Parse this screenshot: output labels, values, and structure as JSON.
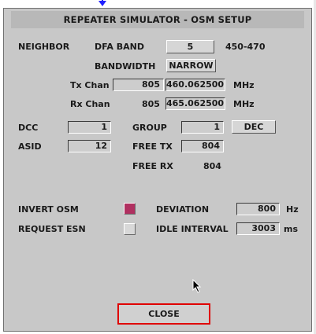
{
  "title": "REPEATER SIMULATOR - OSM SETUP",
  "neighbor": {
    "label": "NEIGHBOR",
    "band_label": "DFA BAND",
    "band_value": "5",
    "band_range": "450-470",
    "bandwidth_label": "BANDWIDTH",
    "bandwidth_value": "NARROW"
  },
  "tx": {
    "label": "Tx Chan",
    "chan": "805",
    "freq": "460.062500",
    "unit": "MHz"
  },
  "rx": {
    "label": "Rx Chan",
    "chan": "805",
    "freq": "465.062500",
    "unit": "MHz"
  },
  "dcc": {
    "label": "DCC",
    "value": "1"
  },
  "group": {
    "label": "GROUP",
    "value": "1",
    "dec_button": "DEC"
  },
  "asid": {
    "label": "ASID",
    "value": "12"
  },
  "free_tx": {
    "label": "FREE TX",
    "value": "804"
  },
  "free_rx": {
    "label": "FREE RX",
    "value": "804"
  },
  "invert_osm": {
    "label": "INVERT OSM",
    "checked": true,
    "color": "#b03060"
  },
  "request_esn": {
    "label": "REQUEST ESN",
    "checked": false
  },
  "deviation": {
    "label": "DEVIATION",
    "value": "800",
    "unit": "Hz"
  },
  "idle_interval": {
    "label": "IDLE INTERVAL",
    "value": "3003",
    "unit": "ms"
  },
  "close_label": "CLOSE",
  "colors": {
    "window_bg": "#c8c8c8",
    "title_bg": "#b8b8b8",
    "highlight": "#e00000",
    "pointer_marker": "#2020ff"
  }
}
